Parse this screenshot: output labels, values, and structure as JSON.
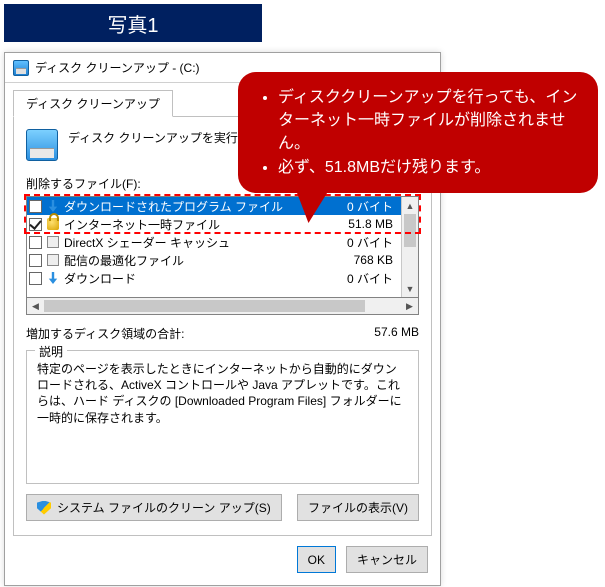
{
  "banner": {
    "title": "写真1"
  },
  "window": {
    "title": "ディスク クリーンアップ - (C:)",
    "tab_label": "ディスク クリーンアップ",
    "intro_text": "ディスク クリーンアップを実行するます。",
    "files_label": "削除するファイル(F):",
    "rows": [
      {
        "name": "ダウンロードされたプログラム ファイル",
        "size": "0 バイト",
        "checked": false,
        "icon": "download-icon",
        "selected": true
      },
      {
        "name": "インターネット一時ファイル",
        "size": "51.8 MB",
        "checked": true,
        "icon": "lock-icon",
        "selected": false
      },
      {
        "name": "DirectX シェーダー キャッシュ",
        "size": "0 バイト",
        "checked": false,
        "icon": "box-icon",
        "selected": false
      },
      {
        "name": "配信の最適化ファイル",
        "size": "768 KB",
        "checked": false,
        "icon": "box-icon",
        "selected": false
      },
      {
        "name": "ダウンロード",
        "size": "0 バイト",
        "checked": false,
        "icon": "download-icon",
        "selected": false
      }
    ],
    "gain_label": "増加するディスク領域の合計:",
    "gain_value": "57.6 MB",
    "desc_group_label": "説明",
    "desc_text": "特定のページを表示したときにインターネットから自動的にダウンロードされる、ActiveX コントロールや Java アプレットです。これらは、ハード ディスクの [Downloaded Program Files] フォルダーに一時的に保存されます。",
    "btn_system_cleanup": "システム ファイルのクリーン アップ(S)",
    "btn_view_files": "ファイルの表示(V)",
    "btn_ok": "OK",
    "btn_cancel": "キャンセル"
  },
  "callout": {
    "bullet1": "ディスククリーンアップを行っても、インターネット一時ファイルが削除されません。",
    "bullet2": "必ず、51.8MBだけ残ります。"
  },
  "colors": {
    "banner_bg": "#002060",
    "callout_bg": "#c00000",
    "highlight": "#ff0000",
    "selection": "#0070d0"
  }
}
